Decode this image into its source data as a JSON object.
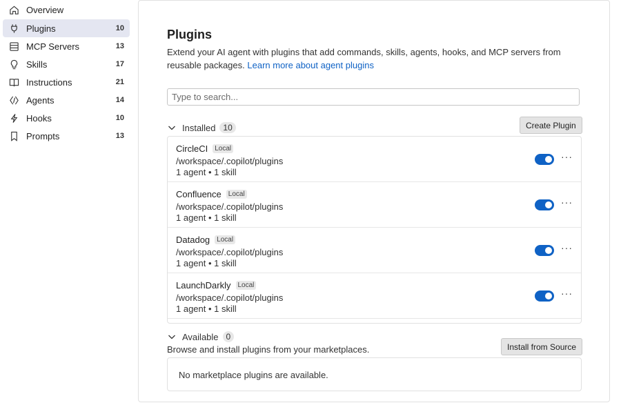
{
  "sidebar": {
    "items": [
      {
        "label": "Overview",
        "count": "",
        "icon": "home-icon"
      },
      {
        "label": "Plugins",
        "count": "10",
        "icon": "plug-icon",
        "active": true
      },
      {
        "label": "MCP Servers",
        "count": "13",
        "icon": "server-icon"
      },
      {
        "label": "Skills",
        "count": "17",
        "icon": "lightbulb-icon"
      },
      {
        "label": "Instructions",
        "count": "21",
        "icon": "book-icon"
      },
      {
        "label": "Agents",
        "count": "14",
        "icon": "agent-icon"
      },
      {
        "label": "Hooks",
        "count": "10",
        "icon": "lightning-icon"
      },
      {
        "label": "Prompts",
        "count": "13",
        "icon": "bookmark-icon"
      }
    ]
  },
  "main": {
    "title": "Plugins",
    "description": "Extend your AI agent with plugins that add commands, skills, agents, hooks, and MCP servers from reusable packages.",
    "learn_more": "Learn more about agent plugins",
    "search_placeholder": "Type to search...",
    "installed": {
      "label": "Installed",
      "count": "10",
      "create_button": "Create Plugin",
      "plugins": [
        {
          "name": "CircleCI",
          "badge": "Local",
          "path": "/workspace/.copilot/plugins",
          "meta": "1 agent • 1 skill",
          "enabled": true
        },
        {
          "name": "Confluence",
          "badge": "Local",
          "path": "/workspace/.copilot/plugins",
          "meta": "1 agent • 1 skill",
          "enabled": true
        },
        {
          "name": "Datadog",
          "badge": "Local",
          "path": "/workspace/.copilot/plugins",
          "meta": "1 agent • 1 skill",
          "enabled": true
        },
        {
          "name": "LaunchDarkly",
          "badge": "Local",
          "path": "/workspace/.copilot/plugins",
          "meta": "1 agent • 1 skill",
          "enabled": true
        }
      ]
    },
    "available": {
      "label": "Available",
      "count": "0",
      "install_button": "Install from Source",
      "description": "Browse and install plugins from your marketplaces.",
      "empty_text": "No marketplace plugins are available."
    }
  },
  "colors": {
    "accent": "#0f62c5",
    "active_bg": "#e4e6f1"
  }
}
